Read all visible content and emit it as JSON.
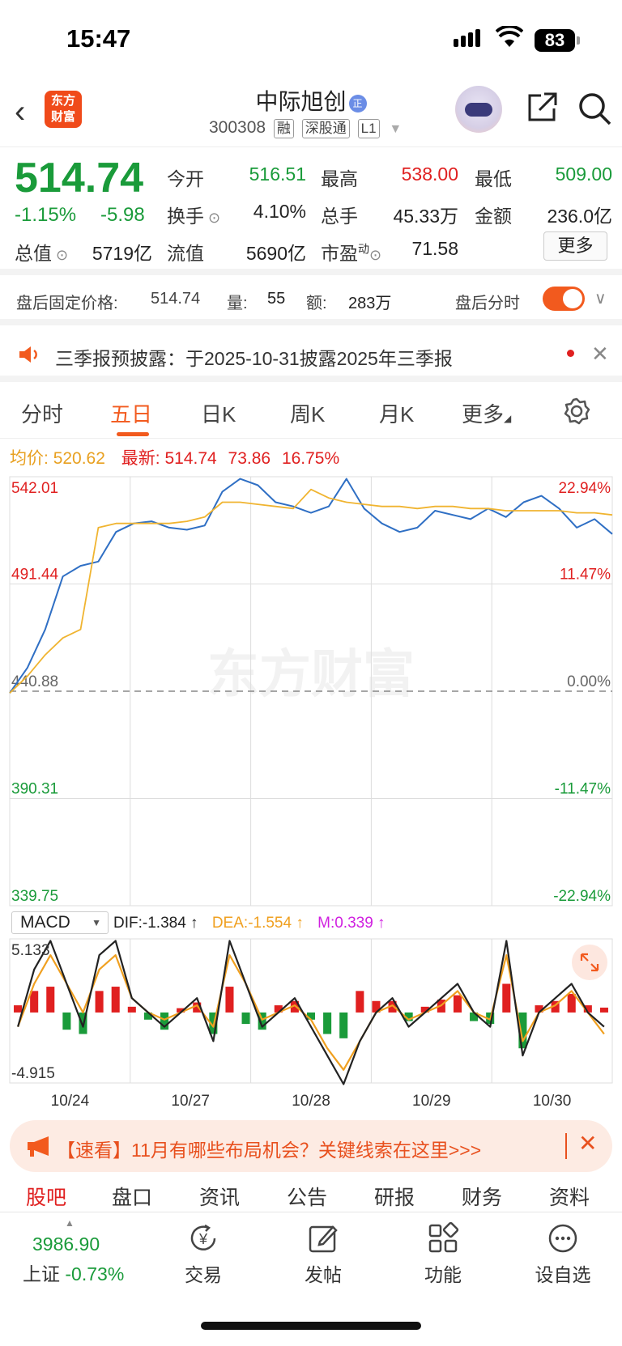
{
  "status": {
    "time": "15:47",
    "battery": "83"
  },
  "header": {
    "logo_text": "东方\n财富",
    "name": "中际旭创",
    "name_badge": "正",
    "code": "300308",
    "tags": [
      "融",
      "深股通",
      "L1"
    ]
  },
  "quote": {
    "price": "514.74",
    "change_pct": "-1.15%",
    "change": "-5.98",
    "open_label": "今开",
    "open": "516.51",
    "high_label": "最高",
    "high": "538.00",
    "low_label": "最低",
    "low": "509.00",
    "turnover_label": "换手",
    "turnover": "4.10%",
    "volume_label": "总手",
    "volume": "45.33万",
    "amount_label": "金额",
    "amount": "236.0亿",
    "mcap_label": "总值",
    "mcap": "5719亿",
    "float_label": "流值",
    "float": "5690亿",
    "pe_label": "市盈",
    "pe_sup": "动",
    "pe": "71.58",
    "more": "更多"
  },
  "after_hours": {
    "label": "盘后固定价格:",
    "price": "514.74",
    "vol_label": "量:",
    "vol": "55",
    "amt_label": "额:",
    "amt": "283万",
    "toggle_label": "盘后分时"
  },
  "notice": {
    "text": "三季报预披露：于2025-10-31披露2025年三季报"
  },
  "tabs": [
    "分时",
    "五日",
    "日K",
    "周K",
    "月K",
    "更多"
  ],
  "active_tab": 1,
  "legend": {
    "avg_label": "均价:",
    "avg": "520.62",
    "last_label": "最新:",
    "last": "514.74",
    "last_chg": "73.86",
    "last_pct": "16.75%"
  },
  "chart_data": [
    {
      "type": "line",
      "title": "",
      "x": [
        "10/24",
        "10/27",
        "10/28",
        "10/29",
        "10/30"
      ],
      "y_ticks_left": [
        "542.01",
        "491.44",
        "440.88",
        "390.31",
        "339.75"
      ],
      "y_ticks_right": [
        "22.94%",
        "11.47%",
        "0.00%",
        "-11.47%",
        "-22.94%"
      ],
      "ylim": [
        339.75,
        542.01
      ],
      "reference": 440.88,
      "watermark": "东方财富",
      "series": [
        {
          "name": "",
          "color": "#2f6fc4",
          "values": [
            440,
            452,
            470,
            495,
            500,
            502,
            516,
            520,
            521,
            518,
            517,
            519,
            535,
            541,
            538,
            530,
            528,
            525,
            528,
            541,
            527,
            520,
            516,
            518,
            526,
            524,
            522,
            527,
            523,
            530,
            533,
            527,
            518,
            522,
            515
          ]
        },
        {
          "name": "",
          "color": "#f0b430",
          "values": [
            440,
            448,
            458,
            466,
            470,
            518,
            520,
            520,
            520,
            520,
            521,
            523,
            530,
            530,
            529,
            528,
            527,
            536,
            532,
            530,
            529,
            528,
            528,
            527,
            528,
            528,
            527,
            527,
            526,
            526,
            526,
            526,
            525,
            525,
            524
          ]
        }
      ]
    },
    {
      "type": "bar",
      "title": "MACD",
      "dif_label": "DIF:",
      "dif": "-1.384",
      "dea_label": "DEA:",
      "dea": "-1.554",
      "m_label": "M:",
      "m": "0.339",
      "y_ticks": [
        "5.133",
        "-4.915"
      ],
      "ylim": [
        -4.915,
        5.133
      ],
      "series": [
        {
          "name": "DIF",
          "color": "#222222",
          "values": [
            -1,
            3,
            5,
            2,
            -1,
            4,
            5,
            1,
            0,
            -1,
            0,
            1,
            -2,
            5,
            2,
            -1,
            0,
            1,
            -1,
            -3,
            -5,
            -2,
            0,
            1,
            -1,
            0,
            1,
            2,
            0,
            -1,
            5,
            -3,
            0,
            1,
            2,
            0,
            -1
          ]
        },
        {
          "name": "DEA",
          "color": "#f0a020",
          "values": [
            -1,
            2,
            4,
            2,
            0,
            3,
            4,
            1,
            0,
            -0.5,
            0,
            0.5,
            -1,
            4,
            2,
            -0.5,
            0,
            0.5,
            -0.5,
            -2.5,
            -4,
            -2,
            0,
            0.5,
            -0.5,
            0,
            0.5,
            1.5,
            0,
            -0.5,
            4,
            -2,
            0,
            0.5,
            1.5,
            0,
            -1.5
          ]
        },
        {
          "name": "M",
          "color": "#e02020",
          "values": [
            0.5,
            1.5,
            1.8,
            -1.2,
            -1.5,
            1.5,
            1.8,
            0.4,
            -0.5,
            -1.2,
            0.3,
            0.7,
            -1.5,
            1.8,
            -0.8,
            -1.2,
            0.5,
            0.8,
            -0.5,
            -1.5,
            -1.8,
            1.5,
            0.8,
            0.8,
            -0.6,
            0.4,
            0.9,
            1.2,
            -0.6,
            -0.8,
            2,
            -2.5,
            0.5,
            0.8,
            1.3,
            0.5,
            0.34
          ]
        }
      ]
    }
  ],
  "banner": {
    "text": "【速看】11月有哪些布局机会？关键线索在这里>>>"
  },
  "bottom_tabs": [
    "股吧",
    "盘口",
    "资讯",
    "公告",
    "研报",
    "财务",
    "资料"
  ],
  "nav": {
    "index_value": "3986.90",
    "index_name": "上证",
    "index_pct": "-0.73%",
    "items": [
      {
        "label": "交易",
        "icon": "trade-icon"
      },
      {
        "label": "发帖",
        "icon": "edit-icon"
      },
      {
        "label": "功能",
        "icon": "grid-icon"
      },
      {
        "label": "设自选",
        "icon": "more-circle-icon"
      }
    ]
  }
}
